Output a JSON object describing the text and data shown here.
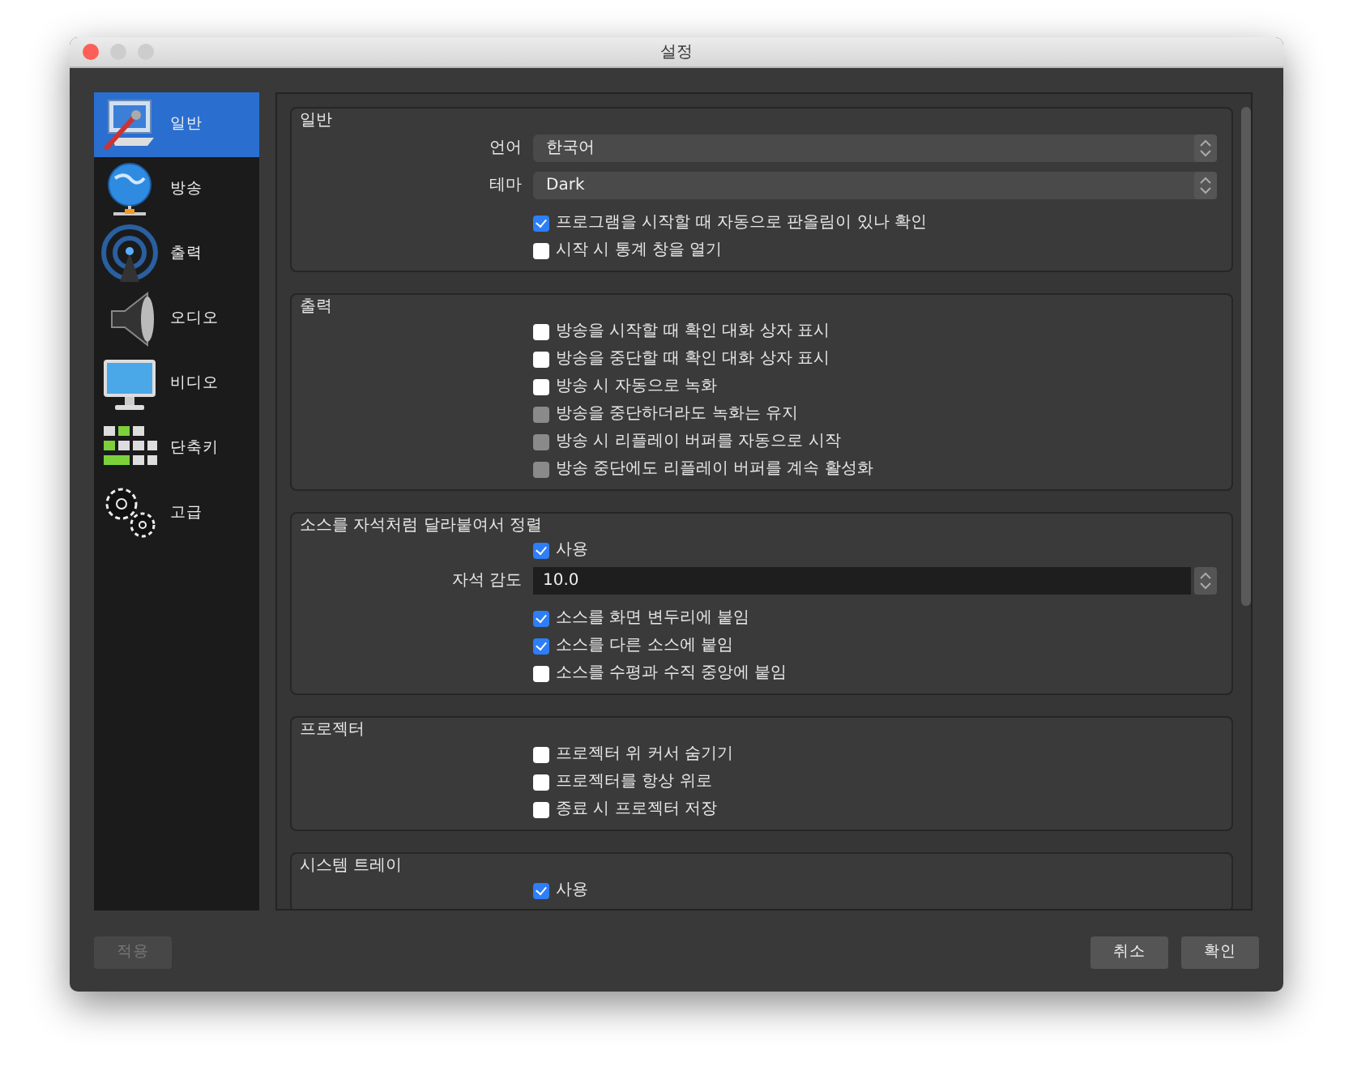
{
  "window": {
    "title": "설정"
  },
  "sidebar": {
    "items": [
      {
        "label": "일반",
        "selected": true
      },
      {
        "label": "방송",
        "selected": false
      },
      {
        "label": "출력",
        "selected": false
      },
      {
        "label": "오디오",
        "selected": false
      },
      {
        "label": "비디오",
        "selected": false
      },
      {
        "label": "단축키",
        "selected": false
      },
      {
        "label": "고급",
        "selected": false
      }
    ]
  },
  "groups": [
    {
      "title": "일반",
      "rows": [
        {
          "kind": "select",
          "label": "언어",
          "value": "한국어"
        },
        {
          "kind": "select",
          "label": "테마",
          "value": "Dark"
        },
        {
          "kind": "checkbox",
          "label": "프로그램을 시작할 때 자동으로 판올림이 있나 확인",
          "checked": true,
          "disabled": false
        },
        {
          "kind": "checkbox",
          "label": "시작 시 통계 창을 열기",
          "checked": false,
          "disabled": false
        }
      ]
    },
    {
      "title": "출력",
      "rows": [
        {
          "kind": "checkbox",
          "label": "방송을 시작할 때 확인 대화 상자 표시",
          "checked": false,
          "disabled": false
        },
        {
          "kind": "checkbox",
          "label": "방송을 중단할 때 확인 대화 상자 표시",
          "checked": false,
          "disabled": false
        },
        {
          "kind": "checkbox",
          "label": "방송 시 자동으로 녹화",
          "checked": false,
          "disabled": false
        },
        {
          "kind": "checkbox",
          "label": "방송을 중단하더라도 녹화는 유지",
          "checked": false,
          "disabled": true
        },
        {
          "kind": "checkbox",
          "label": "방송 시 리플레이 버퍼를 자동으로 시작",
          "checked": false,
          "disabled": true
        },
        {
          "kind": "checkbox",
          "label": "방송 중단에도 리플레이 버퍼를 계속 활성화",
          "checked": false,
          "disabled": true
        }
      ]
    },
    {
      "title": "소스를 자석처럼 달라붙여서 정렬",
      "rows": [
        {
          "kind": "checkbox",
          "label": "사용",
          "checked": true,
          "disabled": false
        },
        {
          "kind": "spin",
          "label": "자석 감도",
          "value": "10.0"
        },
        {
          "kind": "checkbox",
          "label": "소스를 화면 변두리에 붙임",
          "checked": true,
          "disabled": false
        },
        {
          "kind": "checkbox",
          "label": "소스를 다른 소스에 붙임",
          "checked": true,
          "disabled": false
        },
        {
          "kind": "checkbox",
          "label": "소스를 수평과 수직 중앙에 붙임",
          "checked": false,
          "disabled": false
        }
      ]
    },
    {
      "title": "프로젝터",
      "rows": [
        {
          "kind": "checkbox",
          "label": "프로젝터 위 커서 숨기기",
          "checked": false,
          "disabled": false
        },
        {
          "kind": "checkbox",
          "label": "프로젝터를 항상 위로",
          "checked": false,
          "disabled": false
        },
        {
          "kind": "checkbox",
          "label": "종료 시 프로젝터 저장",
          "checked": false,
          "disabled": false
        }
      ]
    },
    {
      "title": "시스템 트레이",
      "rows": [
        {
          "kind": "checkbox",
          "label": "사용",
          "checked": true,
          "disabled": false
        }
      ]
    }
  ],
  "buttons": [
    {
      "label": "적용",
      "disabled": true
    },
    {
      "label": "취소",
      "disabled": false
    },
    {
      "label": "확인",
      "disabled": false
    }
  ]
}
